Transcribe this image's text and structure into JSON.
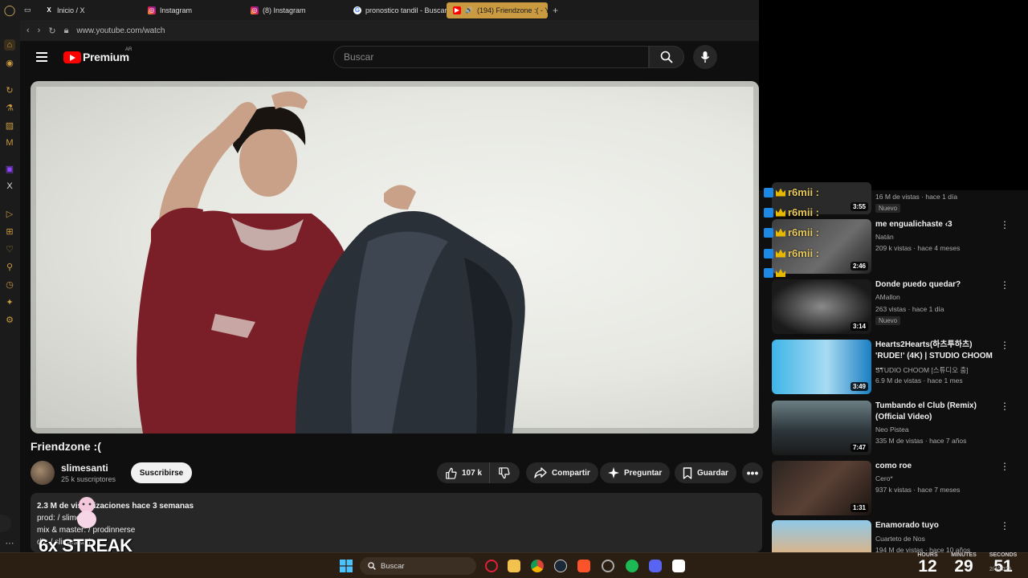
{
  "browser": {
    "tabs": [
      {
        "label": "Inicio / X",
        "icon": "x-icon"
      },
      {
        "label": "Instagram",
        "icon": "instagram-icon"
      },
      {
        "label": "(8) Instagram",
        "icon": "instagram-icon"
      },
      {
        "label": "pronostico tandil - Buscar",
        "icon": "google-icon"
      },
      {
        "label": "(194) Friendzone :( - Y",
        "icon": "youtube-icon",
        "active": true
      }
    ],
    "url": "www.youtube.com/watch",
    "accent": "#c99a40"
  },
  "youtube": {
    "brand": "Premium",
    "region": "AR",
    "search_placeholder": "Buscar"
  },
  "video": {
    "title": "Friendzone :(",
    "channel": "slimesanti",
    "subscribers": "25 k suscriptores",
    "subscribe_label": "Suscribirse",
    "likes": "107 k",
    "share_label": "Compartir",
    "ask_label": "Preguntar",
    "save_label": "Guardar",
    "description": {
      "meta": "2.3 M de visualizaciones hace 3 semanas",
      "line1": "prod:  / slimesurf",
      "line2": "mix & master:  / prodinnerse",
      "line3": "dir:  / slimesanti"
    }
  },
  "overlay": {
    "streak": "6x STREAK",
    "chat_user": "r6mii :"
  },
  "recommendations": [
    {
      "title": "",
      "channel": "",
      "meta": "16 M de vistas · hace 1 día",
      "duration": "3:55",
      "badge": "Nuevo"
    },
    {
      "title": "me engualichaste ‹3",
      "channel": "Natán",
      "meta": "209 k vistas · hace 4 meses",
      "duration": "2:46"
    },
    {
      "title": "Donde puedo quedar?",
      "channel": "AMallon",
      "meta": "263 vistas · hace 1 día",
      "duration": "3:14",
      "badge": "Nuevo"
    },
    {
      "title": "Hearts2Hearts(하츠투하츠) 'RUDE!' (4K) | STUDIO CHOOM ...",
      "channel": "STUDIO CHOOM [스튜디오 춤]",
      "meta": "6.9 M de vistas · hace 1 mes",
      "duration": "3:49"
    },
    {
      "title": "Tumbando el Club (Remix) (Official Video)",
      "channel": "Neo Pistea",
      "meta": "335 M de vistas · hace 7 años",
      "duration": "7:47"
    },
    {
      "title": "como roe",
      "channel": "Cero*",
      "meta": "937 k vistas · hace 7 meses",
      "duration": "1:31"
    },
    {
      "title": "Enamorado tuyo",
      "channel": "Cuarteto de Nos",
      "meta": "194 M de vistas · hace 10 años",
      "duration": ""
    }
  ],
  "taskbar": {
    "search_label": "Buscar",
    "clock": {
      "hours_label": "HOURS",
      "minutes_label": "MINUTES",
      "seconds_label": "SECONDS",
      "hours": "12",
      "minutes": "29",
      "seconds": "51",
      "date": "2/4/2025"
    }
  }
}
